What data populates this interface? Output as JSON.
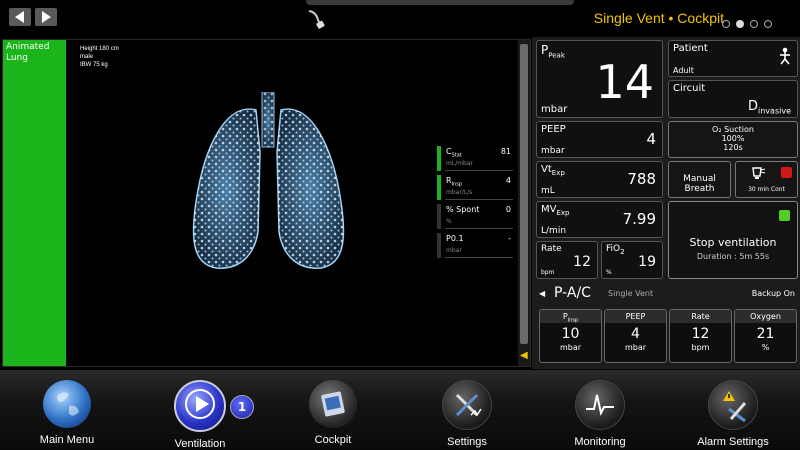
{
  "header": {
    "title": "Single Vent • Cockpit",
    "page_dots": 4,
    "active_dot": 1
  },
  "lung_panel": {
    "label": "Animated Lung",
    "patient_info": [
      "Height 180 cm",
      "male",
      "IBW 75 kg"
    ],
    "params": [
      {
        "name": "C",
        "sub": "Stat",
        "value": "81",
        "unit": "mL/mbar",
        "status": "ok"
      },
      {
        "name": "R",
        "sub": "Insp",
        "value": "4",
        "unit": "mbar/L/s",
        "status": "ok"
      },
      {
        "name": "% Spont",
        "sub": "",
        "value": "0",
        "unit": "%",
        "status": "none"
      },
      {
        "name": "P0.1",
        "sub": "",
        "value": "-",
        "unit": "mbar",
        "status": "none"
      }
    ]
  },
  "monitor": {
    "ppeak": {
      "name": "P",
      "sub": "Peak",
      "value": "14",
      "unit": "mbar"
    },
    "peep": {
      "name": "PEEP",
      "value": "4",
      "unit": "mbar"
    },
    "vt": {
      "name": "Vt",
      "sub": "Exp",
      "value": "788",
      "unit": "mL"
    },
    "mv": {
      "name": "MV",
      "sub": "Exp",
      "value": "7.99",
      "unit": "L/min"
    },
    "rate": {
      "name": "Rate",
      "value": "12",
      "unit": "bpm"
    },
    "fio2": {
      "name": "FiO",
      "sub": "2",
      "value": "19",
      "unit": "%"
    }
  },
  "patient": {
    "label": "Patient",
    "value": "Adult"
  },
  "circuit": {
    "label": "Circuit",
    "value_main": "D",
    "value_sub": "invasive"
  },
  "o2_suction": {
    "label": "O₂ Suction",
    "percent": "100%",
    "time": "120s"
  },
  "manual_breath": {
    "label": "Manual Breath"
  },
  "nebulizer": {
    "label": "30 min Cont"
  },
  "stop_vent": {
    "label": "Stop ventilation",
    "duration_label": "Duration :",
    "duration": "5m 55s"
  },
  "mode": {
    "name": "P-A/C",
    "sub": "Single Vent",
    "backup": "Backup On"
  },
  "controls": [
    {
      "name": "P",
      "sub": "Insp",
      "value": "10",
      "unit": "mbar"
    },
    {
      "name": "PEEP",
      "sub": "",
      "value": "4",
      "unit": "mbar"
    },
    {
      "name": "Rate",
      "sub": "",
      "value": "12",
      "unit": "bpm"
    },
    {
      "name": "Oxygen",
      "sub": "",
      "value": "21",
      "unit": "%"
    }
  ],
  "bottom_nav": [
    {
      "label": "Main Menu",
      "icon": "globe-icon"
    },
    {
      "label": "Ventilation",
      "icon": "play-icon",
      "badge": "1"
    },
    {
      "label": "Cockpit",
      "icon": "cockpit-icon"
    },
    {
      "label": "Settings",
      "icon": "tools-icon"
    },
    {
      "label": "Monitoring",
      "icon": "waveform-icon"
    },
    {
      "label": "Alarm Settings",
      "icon": "alarm-tools-icon"
    }
  ],
  "colors": {
    "accent": "#f2c400",
    "ok_green": "#1bb51b",
    "status_green": "#55cc22",
    "alert_red": "#d01818"
  }
}
